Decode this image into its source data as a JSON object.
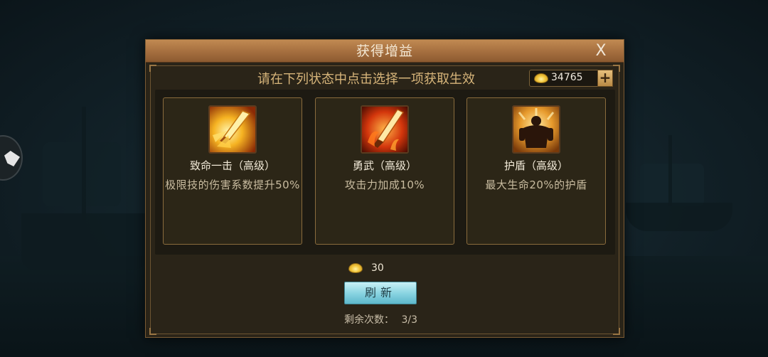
{
  "dialog": {
    "title": "获得增益",
    "close_label": "X",
    "instruction": "请在下列状态中点击选择一项获取生效",
    "gold_balance": "34765",
    "add_gold_label": "+"
  },
  "buffs": [
    {
      "name": "致命一击（高级）",
      "description": "极限技的伤害系数提升50%",
      "icon": "critical-strike-sword-icon"
    },
    {
      "name": "勇武（高级）",
      "description": "攻击力加成10%",
      "icon": "flaming-blade-icon"
    },
    {
      "name": "护盾（高级）",
      "description": "最大生命20%的护盾",
      "icon": "shield-warrior-icon"
    }
  ],
  "refresh": {
    "cost": "30",
    "button_label": "刷新",
    "remaining_label": "剩余次数：",
    "remaining_value": "3/3",
    "remaining_text": "剩余次数：  3/3"
  },
  "colors": {
    "header": "#b07a46",
    "panel": "#2a2418",
    "card_border": "#8a6c3d",
    "refresh_button": "#86d2e0",
    "instruction_text": "#d7b57a"
  }
}
